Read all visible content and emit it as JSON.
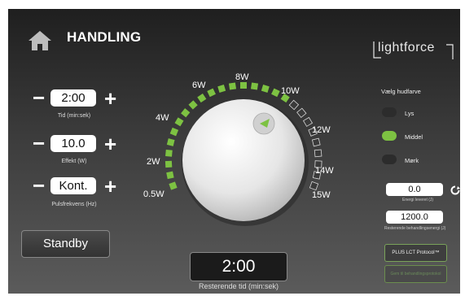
{
  "header": {
    "title": "HANDLING",
    "logo": "lightforce"
  },
  "controls": {
    "time": {
      "value": "2:00",
      "caption": "Tid (min:sek)"
    },
    "power": {
      "value": "10.0",
      "caption": "Effekt (W)"
    },
    "pulse": {
      "value": "Kont.",
      "caption": "Pulsfrekvens (Hz)"
    },
    "minus": "−",
    "plus": "+"
  },
  "standby_label": "Standby",
  "dial": {
    "labels": [
      "0.5W",
      "2W",
      "4W",
      "6W",
      "8W",
      "10W",
      "12W",
      "14W",
      "15W"
    ],
    "level_fraction": 0.67
  },
  "remaining": {
    "value": "2:00",
    "caption": "Resterende tid (min:sek)"
  },
  "skin": {
    "title": "Vælg hudfarve",
    "options": [
      {
        "label": "Lys",
        "selected": false
      },
      {
        "label": "Middel",
        "selected": true
      },
      {
        "label": "Mørk",
        "selected": false
      }
    ]
  },
  "energy": {
    "delivered": "0.0",
    "delivered_caption": "Energi leveret (J)",
    "remaining": "1200.0",
    "remaining_caption": "Resterende behandlingsenergi (J)"
  },
  "protocol_button": "PLUS LCT Protocol™",
  "protocol_button_2": "Gem til behandlingsprotokol",
  "colors": {
    "accent": "#7dc242",
    "background": "#333333"
  }
}
